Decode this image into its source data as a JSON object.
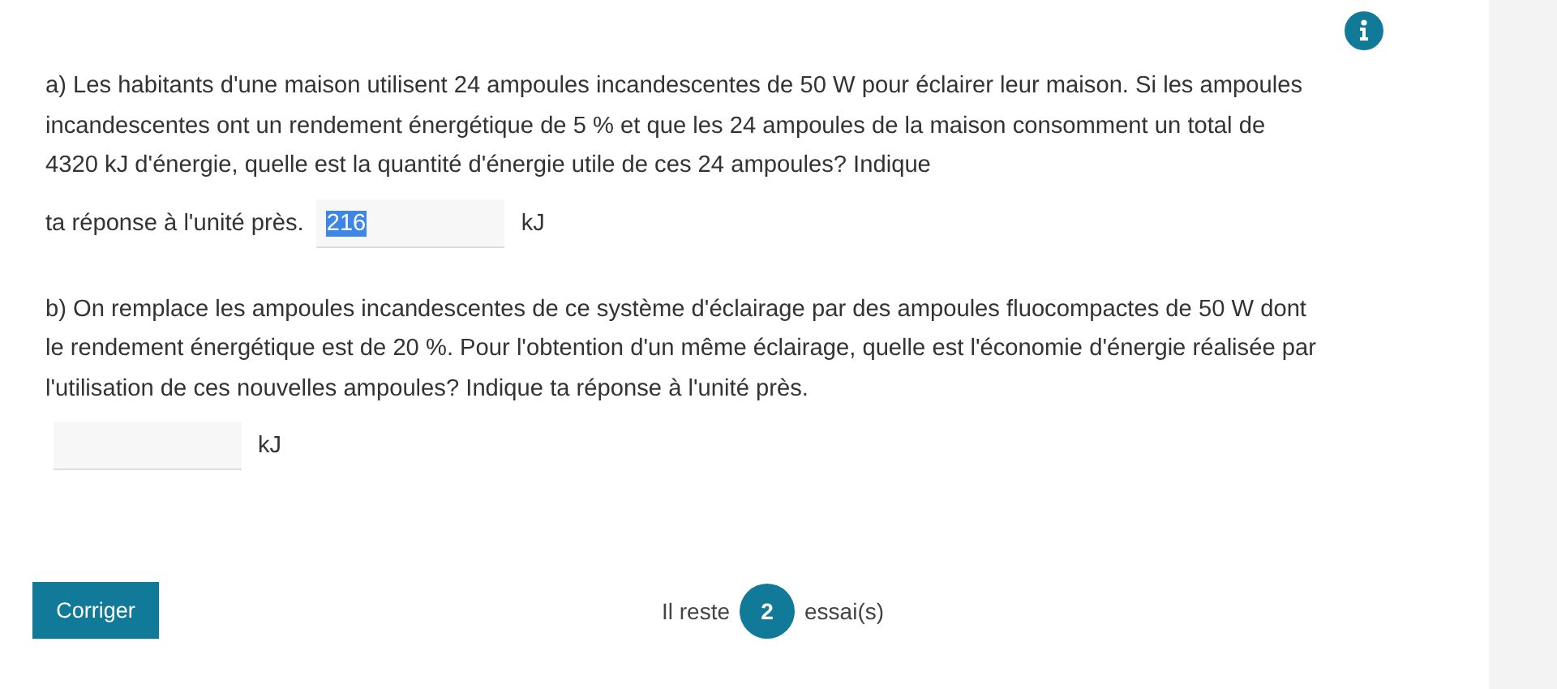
{
  "questions": [
    {
      "text": "a) Les habitants d'une maison utilisent 24 ampoules incandescentes de 50 W pour éclairer leur maison. Si les ampoules incandescentes ont un rendement énergétique de 5 % et que les 24 ampoules de la maison consomment un total de 4320 kJ d'énergie, quelle est la quantité d'énergie utile de ces 24 ampoules? Indique",
      "lead_in": "ta réponse à l'unité près.",
      "answer": {
        "value": "216",
        "highlighted": true
      },
      "unit": "kJ"
    },
    {
      "text": "b) On remplace les ampoules incandescentes de ce système d'éclairage par des ampoules fluocompactes de 50 W dont le rendement énergétique est de 20 %. Pour l'obtention d'un même éclairage, quelle est l'économie d'énergie réalisée par l'utilisation de ces nouvelles ampoules? Indique ta réponse à l'unité près.",
      "unit": "kJ"
    }
  ],
  "footer": {
    "button": "Corriger",
    "attempts_before": "Il reste",
    "attempts_count": "2",
    "attempts_after": "essai(s)"
  }
}
